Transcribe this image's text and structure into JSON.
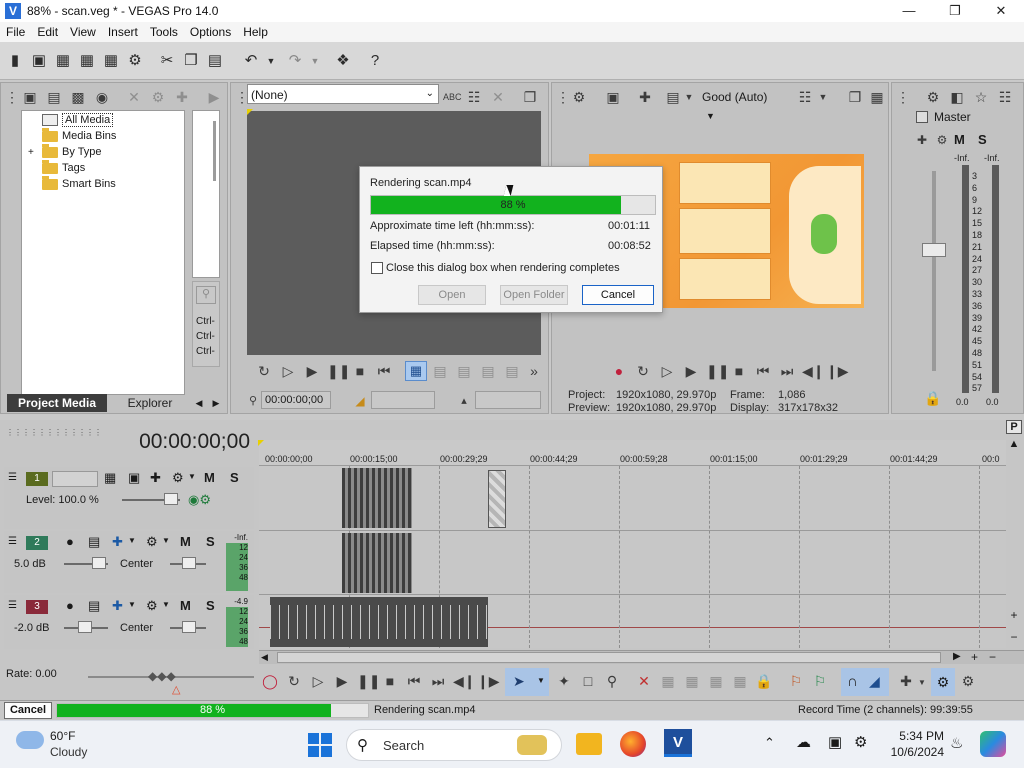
{
  "window": {
    "title": "88% - scan.veg * - VEGAS Pro 14.0",
    "logo": "V"
  },
  "menu": [
    "File",
    "Edit",
    "View",
    "Insert",
    "Tools",
    "Options",
    "Help"
  ],
  "project_media": {
    "tree": [
      "All Media",
      "Media Bins",
      "By Type",
      "Tags",
      "Smart Bins"
    ],
    "expander": "+",
    "tabs": {
      "active": "Project Media",
      "other": "Explorer"
    },
    "side_labels": [
      "Ctrl-",
      "Ctrl-",
      "Ctrl-"
    ]
  },
  "trimmer": {
    "dropdown_value": "(None)",
    "timecode": "00:00:00;00"
  },
  "preview": {
    "quality": "Good (Auto)",
    "project_label": "Project:",
    "project_value": "1920x1080, 29.970p",
    "preview_label": "Preview:",
    "preview_value": "1920x1080, 29.970p",
    "frame_label": "Frame:",
    "frame_value": "1,086",
    "display_label": "Display:",
    "display_value": "317x178x32"
  },
  "master": {
    "label": "Master",
    "m": "M",
    "s": "S",
    "scale": [
      "-Inf.",
      "-Inf.",
      "3",
      "6",
      "9",
      "12",
      "15",
      "18",
      "21",
      "24",
      "27",
      "30",
      "33",
      "36",
      "39",
      "42",
      "45",
      "48",
      "51",
      "54",
      "57"
    ],
    "readout_left": "0.0",
    "readout_right": "0.0"
  },
  "render_dialog": {
    "title": "Rendering scan.mp4",
    "progress_label": "88 %",
    "progress_value": 0.88,
    "time_left_label": "Approximate time left (hh:mm:ss):",
    "time_left_value": "00:01:11",
    "elapsed_label": "Elapsed time (hh:mm:ss):",
    "elapsed_value": "00:08:52",
    "checkbox_label": "Close this dialog box when rendering completes",
    "btn_open": "Open",
    "btn_open_folder": "Open Folder",
    "btn_cancel": "Cancel"
  },
  "timeline": {
    "timecode": "00:00:00;00",
    "ruler": [
      "00:00:00;00",
      "00:00:15;00",
      "00:00:29;29",
      "00:00:44;29",
      "00:00:59;28",
      "00:01:15;00",
      "00:01:29;29",
      "00:01:44;29",
      "00:0"
    ],
    "tracks": [
      {
        "num": "1",
        "level": "Level: 100.0 %",
        "m": "M",
        "s": "S",
        "color": "#5a6b1f"
      },
      {
        "num": "2",
        "vol": "5.0 dB",
        "pan": "Center",
        "m": "M",
        "s": "S",
        "color": "#2f7a5a",
        "meter": [
          "-Inf.",
          "12",
          "24",
          "36",
          "48"
        ]
      },
      {
        "num": "3",
        "vol": "-2.0 dB",
        "pan": "Center",
        "m": "M",
        "s": "S",
        "color": "#8a2a3a",
        "meter": [
          "-4.9",
          "12",
          "24",
          "36",
          "48"
        ]
      }
    ],
    "rate": "Rate: 0.00",
    "p_button": "P"
  },
  "status": {
    "cancel": "Cancel",
    "progress_label": "88 %",
    "progress_value": 0.88,
    "message": "Rendering scan.mp4",
    "record_time": "Record Time (2 channels): 99:39:55"
  },
  "taskbar": {
    "temp": "60°F",
    "weather": "Cloudy",
    "search": "Search",
    "time": "5:34 PM",
    "date": "10/6/2024"
  }
}
